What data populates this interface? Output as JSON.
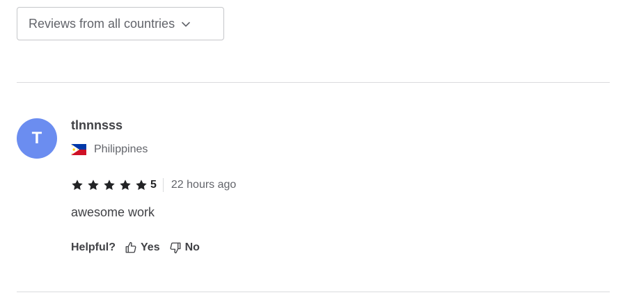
{
  "filter": {
    "label": "Reviews from all countries",
    "icon": "chevron-down-icon"
  },
  "review": {
    "avatar_initial": "T",
    "avatar_color": "#6b8df0",
    "username": "tlnnnsss",
    "country": "Philippines",
    "flag_icon": "philippines-flag-icon",
    "stars": 5,
    "rating_value": "5",
    "time_ago": "22 hours ago",
    "text": "awesome work"
  },
  "helpful": {
    "label": "Helpful?",
    "yes_label": "Yes",
    "no_label": "No",
    "yes_icon": "thumbs-up-icon",
    "no_icon": "thumbs-down-icon"
  }
}
